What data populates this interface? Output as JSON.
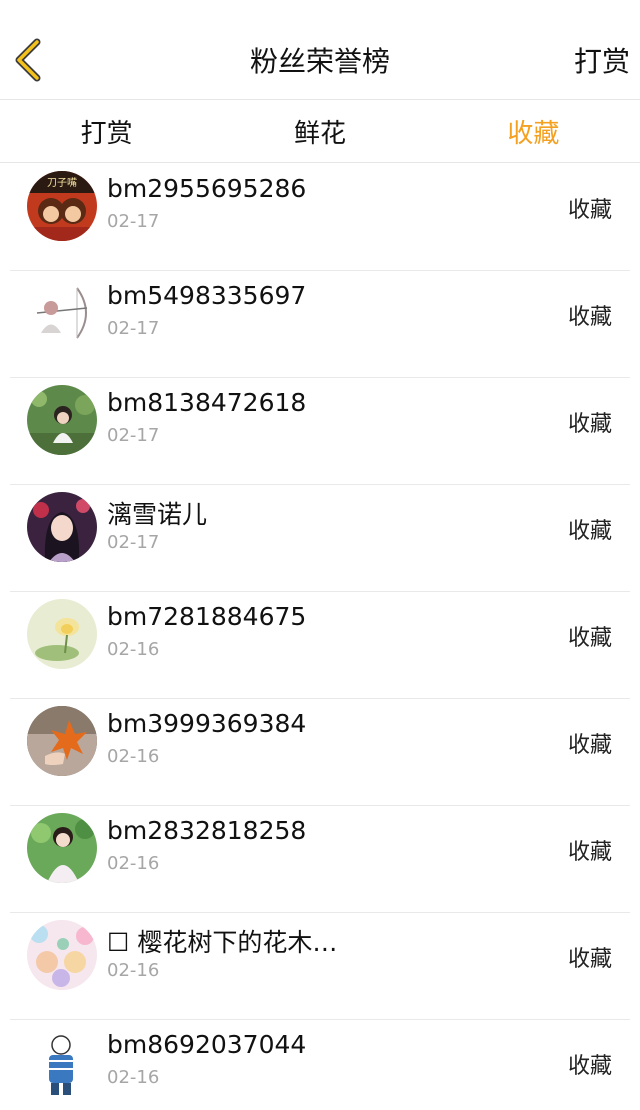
{
  "header": {
    "title": "粉丝荣誉榜",
    "right_label": "打赏",
    "accent_color": "#f4a020"
  },
  "tabs": [
    {
      "label": "打赏",
      "active": false
    },
    {
      "label": "鲜花",
      "active": false
    },
    {
      "label": "收藏",
      "active": true
    }
  ],
  "fans": [
    {
      "name": "bm2955695286",
      "date": "02-17",
      "action": "收藏",
      "avatar": "cartoon-kids-avatar"
    },
    {
      "name": "bm5498335697",
      "date": "02-17",
      "action": "收藏",
      "avatar": "archer-sketch-avatar"
    },
    {
      "name": "bm8138472618",
      "date": "02-17",
      "action": "收藏",
      "avatar": "girl-in-garden-avatar"
    },
    {
      "name": "漓雪诺儿",
      "date": "02-17",
      "action": "收藏",
      "avatar": "anime-girl-avatar"
    },
    {
      "name": "bm7281884675",
      "date": "02-16",
      "action": "收藏",
      "avatar": "lotus-painting-avatar"
    },
    {
      "name": "bm3999369384",
      "date": "02-16",
      "action": "收藏",
      "avatar": "maple-leaf-hand-avatar"
    },
    {
      "name": "bm2832818258",
      "date": "02-16",
      "action": "收藏",
      "avatar": "girl-in-white-avatar"
    },
    {
      "name": "☐ 樱花树下的花木…",
      "date": "02-16",
      "action": "收藏",
      "avatar": "pastel-anime-avatar"
    },
    {
      "name": "bm8692037044",
      "date": "02-16",
      "action": "收藏",
      "avatar": "boy-cartoon-avatar"
    }
  ]
}
